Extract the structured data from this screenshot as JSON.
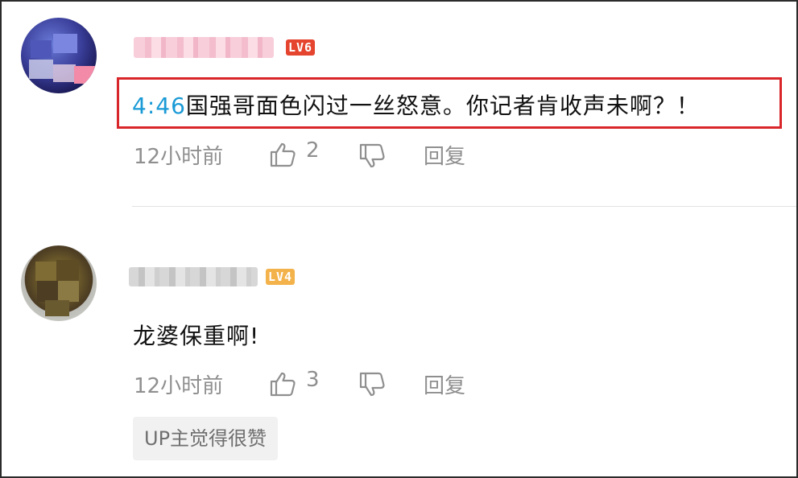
{
  "comments": [
    {
      "level_badge": "LV6",
      "timestamp_link": "4:46",
      "text": "国强哥面色闪过一丝怒意。你记者肯收声未啊？！",
      "time_ago": "12小时前",
      "likes": "2",
      "reply_label": "回复"
    },
    {
      "level_badge": "LV4",
      "text": "龙婆保重啊!",
      "time_ago": "12小时前",
      "likes": "3",
      "reply_label": "回复",
      "up_badge": "UP主觉得很赞"
    }
  ],
  "colors": {
    "highlight_border": "#d9262b",
    "timestamp_link": "#1a9ad6",
    "lv6": "#e5442e",
    "lv4": "#f3b24a",
    "meta_text": "#8f8f8f"
  },
  "icons": [
    "thumbs-up-icon",
    "thumbs-down-icon"
  ]
}
